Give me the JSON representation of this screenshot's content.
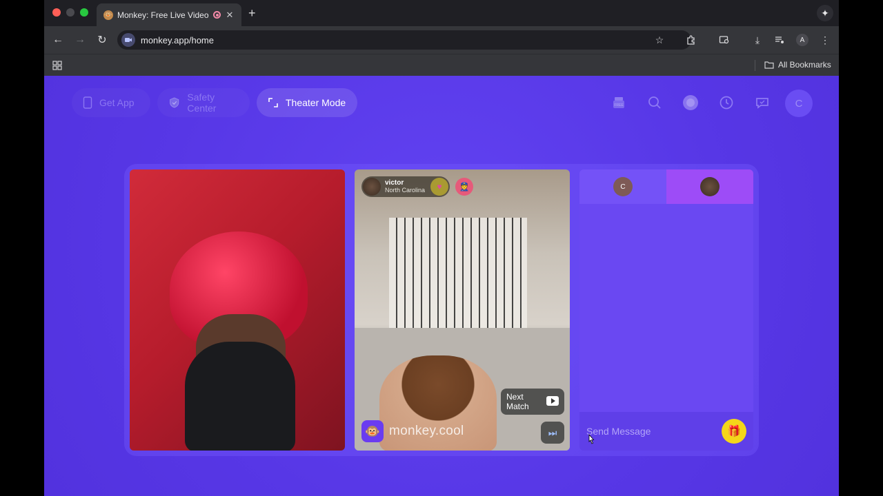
{
  "browser": {
    "tab_title": "Monkey: Free Live Video C",
    "url": "monkey.app/home",
    "bookmarks_label": "All Bookmarks",
    "profile_initial": "A"
  },
  "nav": {
    "get_app": "Get App",
    "safety_center": "Safety Center",
    "theater_mode": "Theater Mode",
    "profile_initial": "C"
  },
  "remote_user": {
    "name": "victor",
    "location": "North Carolina"
  },
  "video": {
    "next_match_label": "Next Match",
    "watermark": "monkey.cool"
  },
  "chat": {
    "my_initial": "C",
    "placeholder": "Send Message"
  },
  "colors": {
    "page_bg": "#5b3bea",
    "accent_yellow": "#f4d61a",
    "chat_other_tab": "#9d4cf7"
  }
}
